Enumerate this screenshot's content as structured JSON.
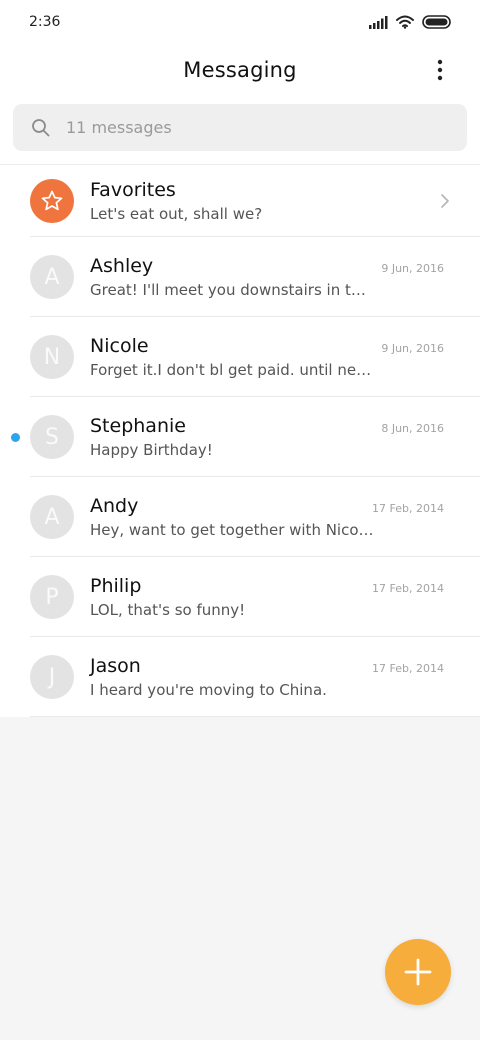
{
  "status_bar": {
    "time": "2:36"
  },
  "header": {
    "title": "Messaging",
    "more_icon": "more-vertical-icon"
  },
  "search": {
    "placeholder": "11 messages",
    "value": "",
    "icon": "search-icon"
  },
  "favorites": {
    "name": "Favorites",
    "preview": "Let's eat out, shall we?",
    "icon": "star-icon",
    "color": "#f0743e"
  },
  "conversations": [
    {
      "initial": "A",
      "name": "Ashley",
      "date": "9 Jun, 2016",
      "preview": "Great! I'll meet you downstairs in t…",
      "unread": false
    },
    {
      "initial": "N",
      "name": "Nicole",
      "date": "9 Jun, 2016",
      "preview": "Forget it.I don't bl get paid. until ne…",
      "unread": false
    },
    {
      "initial": "S",
      "name": "Stephanie",
      "date": "8 Jun, 2016",
      "preview": "Happy Birthday!",
      "unread": true
    },
    {
      "initial": "A",
      "name": "Andy",
      "date": "17 Feb, 2014",
      "preview": "Hey, want to get together with Nico…",
      "unread": false
    },
    {
      "initial": "P",
      "name": "Philip",
      "date": "17 Feb, 2014",
      "preview": "LOL, that's so funny!",
      "unread": false
    },
    {
      "initial": "J",
      "name": "Jason",
      "date": "17 Feb, 2014",
      "preview": "I heard you're moving to China.",
      "unread": false
    }
  ],
  "fab": {
    "icon": "plus-icon",
    "color": "#f6ad3c"
  },
  "colors": {
    "unread_dot": "#2fa4ec",
    "avatar_bg": "#e3e3e3"
  }
}
